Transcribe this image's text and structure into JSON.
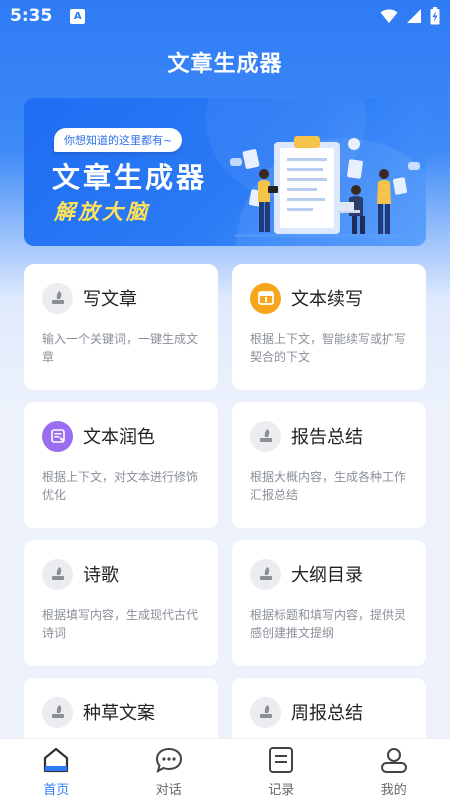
{
  "status_bar": {
    "time": "5:35",
    "app_icon": "A"
  },
  "app_title": "文章生成器",
  "banner": {
    "bubble": "你想知道的这里都有~",
    "title": "文章生成器",
    "subtitle": "解放大脑"
  },
  "cards": [
    {
      "title": "写文章",
      "desc": "输入一个关键词，一键生成文章",
      "icon": "quill-icon"
    },
    {
      "title": "文本续写",
      "desc": "根据上下文，智能续写或扩写契合的下文",
      "icon": "continue-icon"
    },
    {
      "title": "文本润色",
      "desc": "根据上下文，对文本进行修饰优化",
      "icon": "polish-icon"
    },
    {
      "title": "报告总结",
      "desc": "根据大概内容，生成各种工作汇报总结",
      "icon": "quill-icon"
    },
    {
      "title": "诗歌",
      "desc": "根据填写内容，生成现代古代诗词",
      "icon": "quill-icon"
    },
    {
      "title": "大纲目录",
      "desc": "根据标题和填写内容，提供灵感创建推文提纲",
      "icon": "quill-icon"
    },
    {
      "title": "种草文案",
      "desc": "",
      "icon": "quill-icon"
    },
    {
      "title": "周报总结",
      "desc": "",
      "icon": "quill-icon"
    }
  ],
  "nav": {
    "home": "首页",
    "chat": "对话",
    "records": "记录",
    "mine": "我的"
  },
  "colors": {
    "primary": "#2f7bf5",
    "banner_subtitle": "#ffe15a",
    "orange_icon": "#f6a51c",
    "purple_icon": "#9b6df0"
  }
}
